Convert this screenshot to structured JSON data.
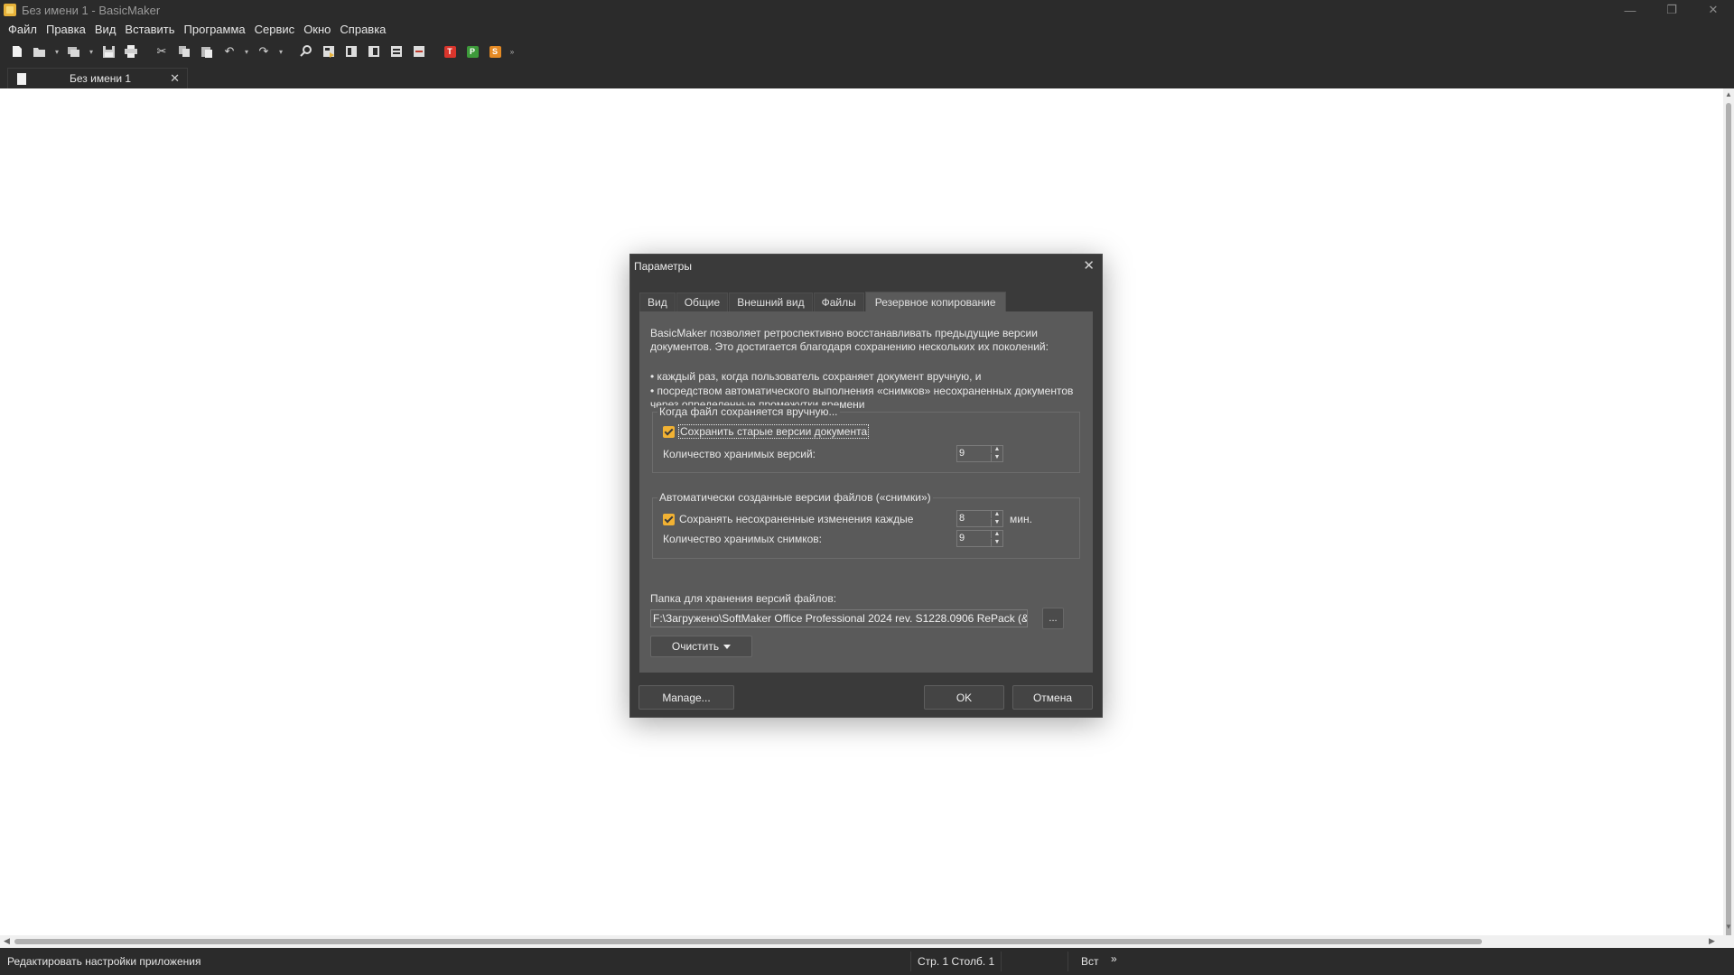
{
  "window": {
    "title": "Без имени 1 - BasicMaker",
    "controls": [
      "—",
      "❐",
      "✕"
    ]
  },
  "menu": [
    "Файл",
    "Правка",
    "Вид",
    "Вставить",
    "Программа",
    "Сервис",
    "Окно",
    "Справка"
  ],
  "toolbar": {
    "badges": {
      "t": "T",
      "p": "P",
      "s": "S"
    },
    "more": "»"
  },
  "document_tab": {
    "label": "Без имени 1",
    "close": "✕"
  },
  "dialog": {
    "title": "Параметры",
    "close": "✕",
    "tabs": [
      "Вид",
      "Общие",
      "Внешний вид",
      "Файлы",
      "Резервное копирование"
    ],
    "active_tab": "Резервное копирование",
    "intro": "BasicMaker позволяет ретроспективно восстанавливать предыдущие версии документов. Это достигается благодаря сохранению нескольких их поколений:",
    "bullet1": "• каждый раз, когда пользователь сохраняет документ вручную, и",
    "bullet2": "• посредством автоматического выполнения «снимков» несохраненных документов через определенные промежутки времени",
    "manual_group": {
      "legend": "Когда файл сохраняется вручную...",
      "keep_versions_label": "Сохранить старые версии документа",
      "keep_versions_checked": true,
      "count_label": "Количество хранимых версий:",
      "count_value": "9"
    },
    "auto_group": {
      "legend": "Автоматически созданные версии файлов («снимки»)",
      "save_every_label": "Сохранять несохраненные изменения каждые",
      "save_every_checked": true,
      "interval_value": "8",
      "interval_unit": "мин.",
      "snapshots_label": "Количество хранимых снимков:",
      "snapshots_value": "9"
    },
    "folder_label": "Папка для хранения версий файлов:",
    "folder_path": "F:\\Загружено\\SoftMaker Office Professional 2024 rev. S1228.0906 RePack (& portable)",
    "browse": "...",
    "clear_button": "Очистить",
    "manage_button": "Manage...",
    "ok_button": "OK",
    "cancel_button": "Отмена"
  },
  "status": {
    "message": "Редактировать настройки приложения",
    "position": "Стр. 1 Столб. 1",
    "mode": "Вст",
    "more": "»"
  },
  "colors": {
    "accent_checkbox": "#f2b233",
    "chrome": "#2b2b2b",
    "dialog_panel": "#5a5a5a"
  }
}
